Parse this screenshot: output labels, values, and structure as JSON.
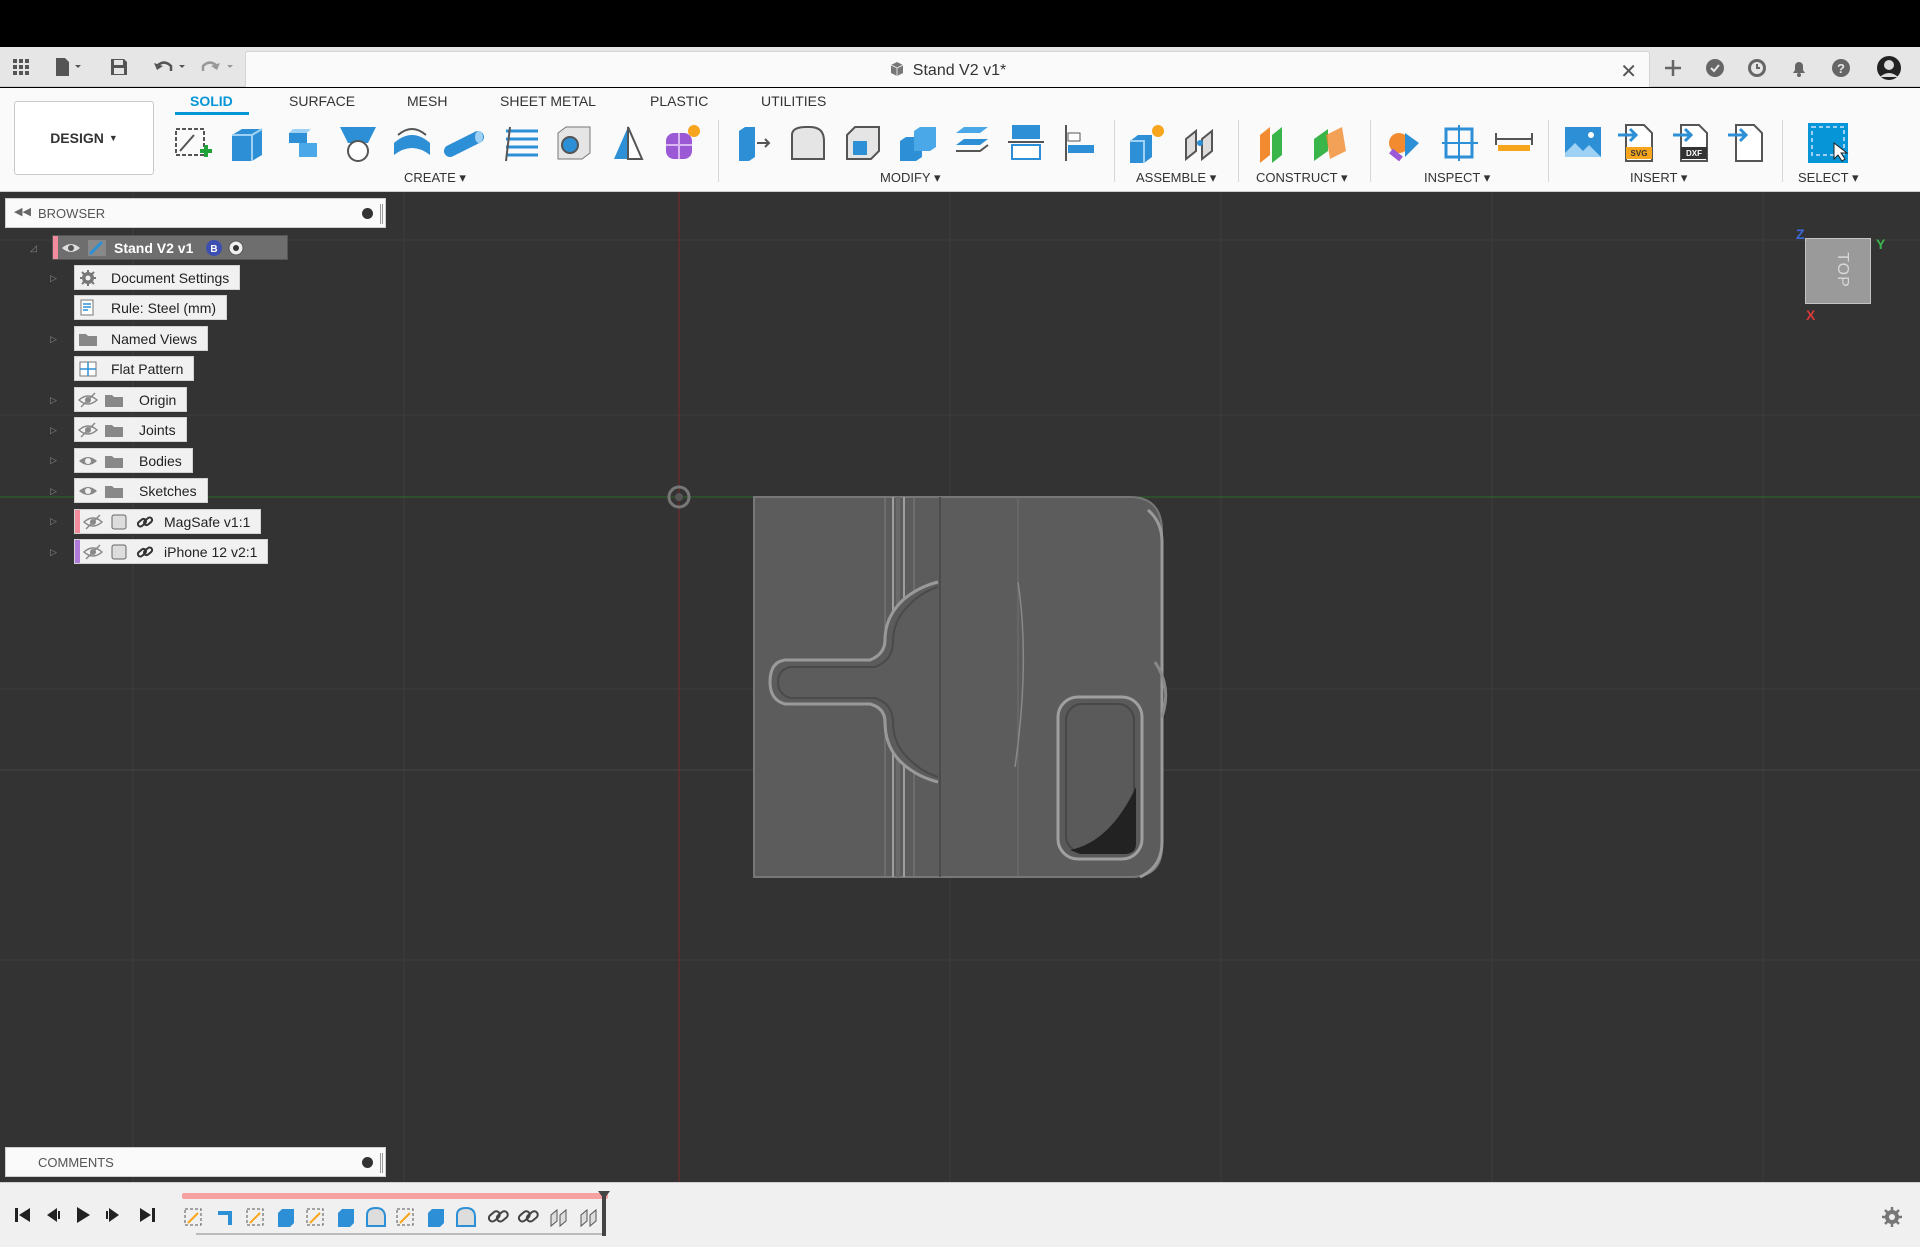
{
  "window": {
    "document_title": "Stand V2 v1*"
  },
  "ribbon": {
    "workspace_label": "DESIGN",
    "tabs": [
      "SOLID",
      "SURFACE",
      "MESH",
      "SHEET METAL",
      "PLASTIC",
      "UTILITIES"
    ],
    "groups": [
      "CREATE",
      "MODIFY",
      "ASSEMBLE",
      "CONSTRUCT",
      "INSPECT",
      "INSERT",
      "SELECT"
    ]
  },
  "browser": {
    "title": "BROWSER",
    "root": {
      "label": "Stand V2 v1",
      "color": "#f28b9b"
    },
    "items": [
      {
        "label": "Document Settings",
        "icon": "gear-icon"
      },
      {
        "label": "Rule: Steel (mm)",
        "icon": "rule-icon"
      },
      {
        "label": "Named Views",
        "icon": "folder-icon"
      },
      {
        "label": "Flat Pattern",
        "icon": "flat-pattern-icon"
      },
      {
        "label": "Origin",
        "icon": "folder-icon"
      },
      {
        "label": "Joints",
        "icon": "folder-icon"
      },
      {
        "label": "Bodies",
        "icon": "folder-icon"
      },
      {
        "label": "Sketches",
        "icon": "folder-icon"
      },
      {
        "label": "MagSafe v1:1",
        "icon": "component-icon",
        "color": "#f28b9b"
      },
      {
        "label": "iPhone 12 v2:1",
        "icon": "component-icon",
        "color": "#b07ad8"
      }
    ]
  },
  "comments": {
    "title": "COMMENTS"
  },
  "viewcube": {
    "face_label": "TOP",
    "axes": {
      "z": "Z",
      "y": "Y",
      "x": "X"
    }
  },
  "colors": {
    "accent": "#0696d7",
    "canvas": "#333333",
    "model_body": "#5c5c5c"
  }
}
